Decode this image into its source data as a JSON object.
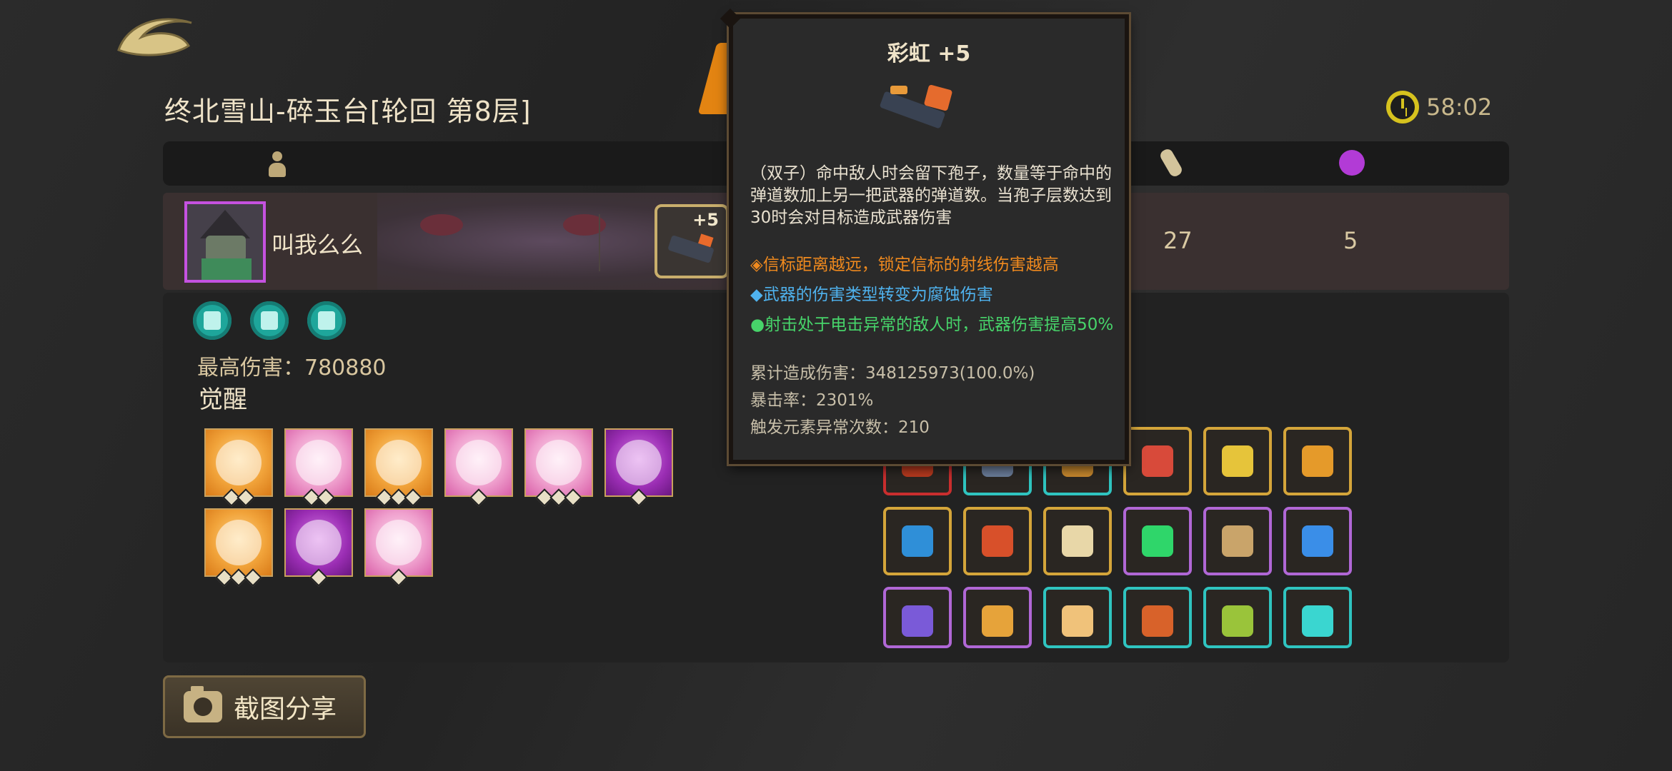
{
  "header": {
    "title": "终北雪山-碎玉台[轮回  第8层]",
    "timer": "58:02"
  },
  "columns": {
    "icons": [
      "person-icon",
      "bone-icon",
      "poison-icon"
    ]
  },
  "player": {
    "name": "叫我么么",
    "weapon_level": "+5",
    "stat_bone": "27",
    "stat_poison": "5",
    "max_damage": "最高伤害：780880",
    "awaken_label": "觉醒",
    "awaken_cards": [
      {
        "style": "orange",
        "diamonds": 2
      },
      {
        "style": "pink",
        "diamonds": 2
      },
      {
        "style": "orange",
        "diamonds": 3
      },
      {
        "style": "pink",
        "diamonds": 1
      },
      {
        "style": "pink",
        "diamonds": 3
      },
      {
        "style": "purple",
        "diamonds": 1
      },
      {
        "style": "orange",
        "diamonds": 3
      },
      {
        "style": "purple",
        "diamonds": 1
      },
      {
        "style": "pink",
        "diamonds": 1
      }
    ]
  },
  "tooltip": {
    "title": "彩虹 +5",
    "line1": "（双子）命中敌人时会留下孢子，数量等于命中的弹道数加上另一把武器的弹道数。当孢子层数达到30时会对目标造成武器伤害",
    "line2": "◈信标距离越远，锁定信标的射线伤害越高",
    "line3": "◆武器的伤害类型转变为腐蚀伤害",
    "line4": "●射击处于电击异常的敌人时，武器伤害提高50%",
    "stat1": "累计造成伤害：348125973(100.0%)",
    "stat2": "暴击率：2301%",
    "stat3": "触发元素异常次数：210"
  },
  "weapon_grid": [
    {
      "border": "red",
      "glyph": "#b83a1f"
    },
    {
      "border": "teal",
      "glyph": "#6b7d9a"
    },
    {
      "border": "teal",
      "glyph": "#c9892e"
    },
    {
      "border": "gold",
      "glyph": "#d84a3a"
    },
    {
      "border": "gold",
      "glyph": "#e6c43a"
    },
    {
      "border": "gold",
      "glyph": "#e59a2a"
    },
    {
      "border": "gold",
      "glyph": "#2f8fd8"
    },
    {
      "border": "gold",
      "glyph": "#d8502a"
    },
    {
      "border": "gold",
      "glyph": "#e8d7a8"
    },
    {
      "border": "purple",
      "glyph": "#2fd66a"
    },
    {
      "border": "purple",
      "glyph": "#c9a46a"
    },
    {
      "border": "purple",
      "glyph": "#3a8ee8"
    },
    {
      "border": "purple",
      "glyph": "#7a5ad8"
    },
    {
      "border": "purple",
      "glyph": "#e6a33a"
    },
    {
      "border": "teal",
      "glyph": "#f0c27a"
    },
    {
      "border": "teal",
      "glyph": "#d8622a"
    },
    {
      "border": "teal",
      "glyph": "#9ac43a"
    },
    {
      "border": "teal",
      "glyph": "#3ad6d0"
    }
  ],
  "share": {
    "label": "截图分享"
  }
}
